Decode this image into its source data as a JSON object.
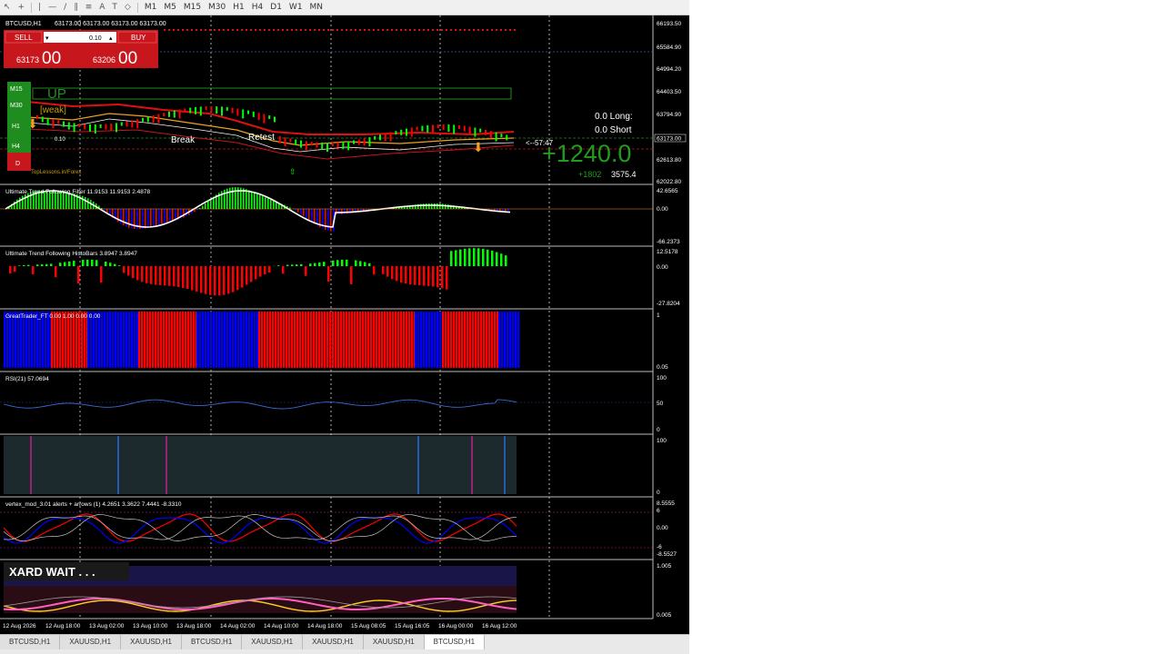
{
  "toolbar": {
    "timeframes": [
      "M1",
      "M5",
      "M15",
      "M30",
      "H1",
      "H4",
      "D1",
      "W1",
      "MN"
    ]
  },
  "chart": {
    "title": "BTCUSD,H1",
    "ohlc": "63173.00 63173.00 63173.00 63173.00",
    "price_scale": [
      "66193.50",
      "65584.90",
      "64994.20",
      "64403.50",
      "63794.90",
      "63173.00",
      "62613.80",
      "62022.80"
    ],
    "current_price_tag": "63173.00",
    "oneclick": {
      "sell_label": "SELL",
      "buy_label": "BUY",
      "lot": "0.10",
      "sell_price_small": "63173",
      "sell_price_big": "00",
      "buy_price_small": "63206",
      "buy_price_big": "00"
    },
    "trend_labels": [
      "M15",
      "M30",
      "H1",
      "H4",
      "D"
    ],
    "trend_state": "UP",
    "trend_strength": "[weak]",
    "buy_note": "0.10",
    "break_label": "Break",
    "retest_label": "Retest",
    "long_text": "0.0  Long:",
    "short_text": "0.0  Short",
    "profit_big": "+1240.0",
    "profit_small": "+1802",
    "profit_small2": "3575.4",
    "timer": "<--57:47",
    "footer": "TopLessons.in/Forex"
  },
  "ind1": {
    "title": "Ultimate Trend Following Filter 11.9153 11.9153 2.4878",
    "scale": [
      "42.6565",
      "0.00",
      "-66.2373"
    ]
  },
  "ind2": {
    "title": "Ultimate Trend Following HistoBars 3.8947 3.8947",
    "scale": [
      "12.5178",
      "0.00",
      "-27.8204"
    ]
  },
  "ind3": {
    "title": "GreatTrader_FT 0.00 1.00 0.00 0.00",
    "scale": [
      "1",
      "0.05"
    ]
  },
  "ind4": {
    "title": "RSI(21) 57.0694",
    "scale": [
      "100",
      "50",
      "0"
    ]
  },
  "ind5": {
    "scale": [
      "100",
      "0"
    ]
  },
  "ind6": {
    "title": "vertex_mod_3.01 alerts + arrows (1) 4.2651 3.3622 7.4441 -8.3310",
    "scale": [
      "8.5555",
      "6",
      "0.00",
      "-6",
      "-8.5527"
    ]
  },
  "ind7": {
    "status": "XARD WAIT . . .",
    "scale": [
      "1.005",
      "0.005"
    ]
  },
  "time_axis": [
    "12 Aug 2026",
    "12 Aug 18:00",
    "13 Aug 02:00",
    "13 Aug 10:00",
    "13 Aug 18:00",
    "14 Aug 02:00",
    "14 Aug 10:00",
    "14 Aug 18:00",
    "15 Aug 08:05",
    "15 Aug 16:05",
    "16 Aug 00:00",
    "16 Aug 12:00"
  ],
  "tabs": [
    "BTCUSD,H1",
    "XAUUSD,H1",
    "XAUUSD,H1",
    "BTCUSD,H1",
    "XAUUSD,H1",
    "XAUUSD,H1",
    "XAUUSD,H1",
    "BTCUSD,H1"
  ],
  "active_tab_index": 7,
  "colors": {
    "bull": "#00ff00",
    "bear": "#ff0000",
    "blue": "#0000ff",
    "panel_bg": "#000000"
  }
}
